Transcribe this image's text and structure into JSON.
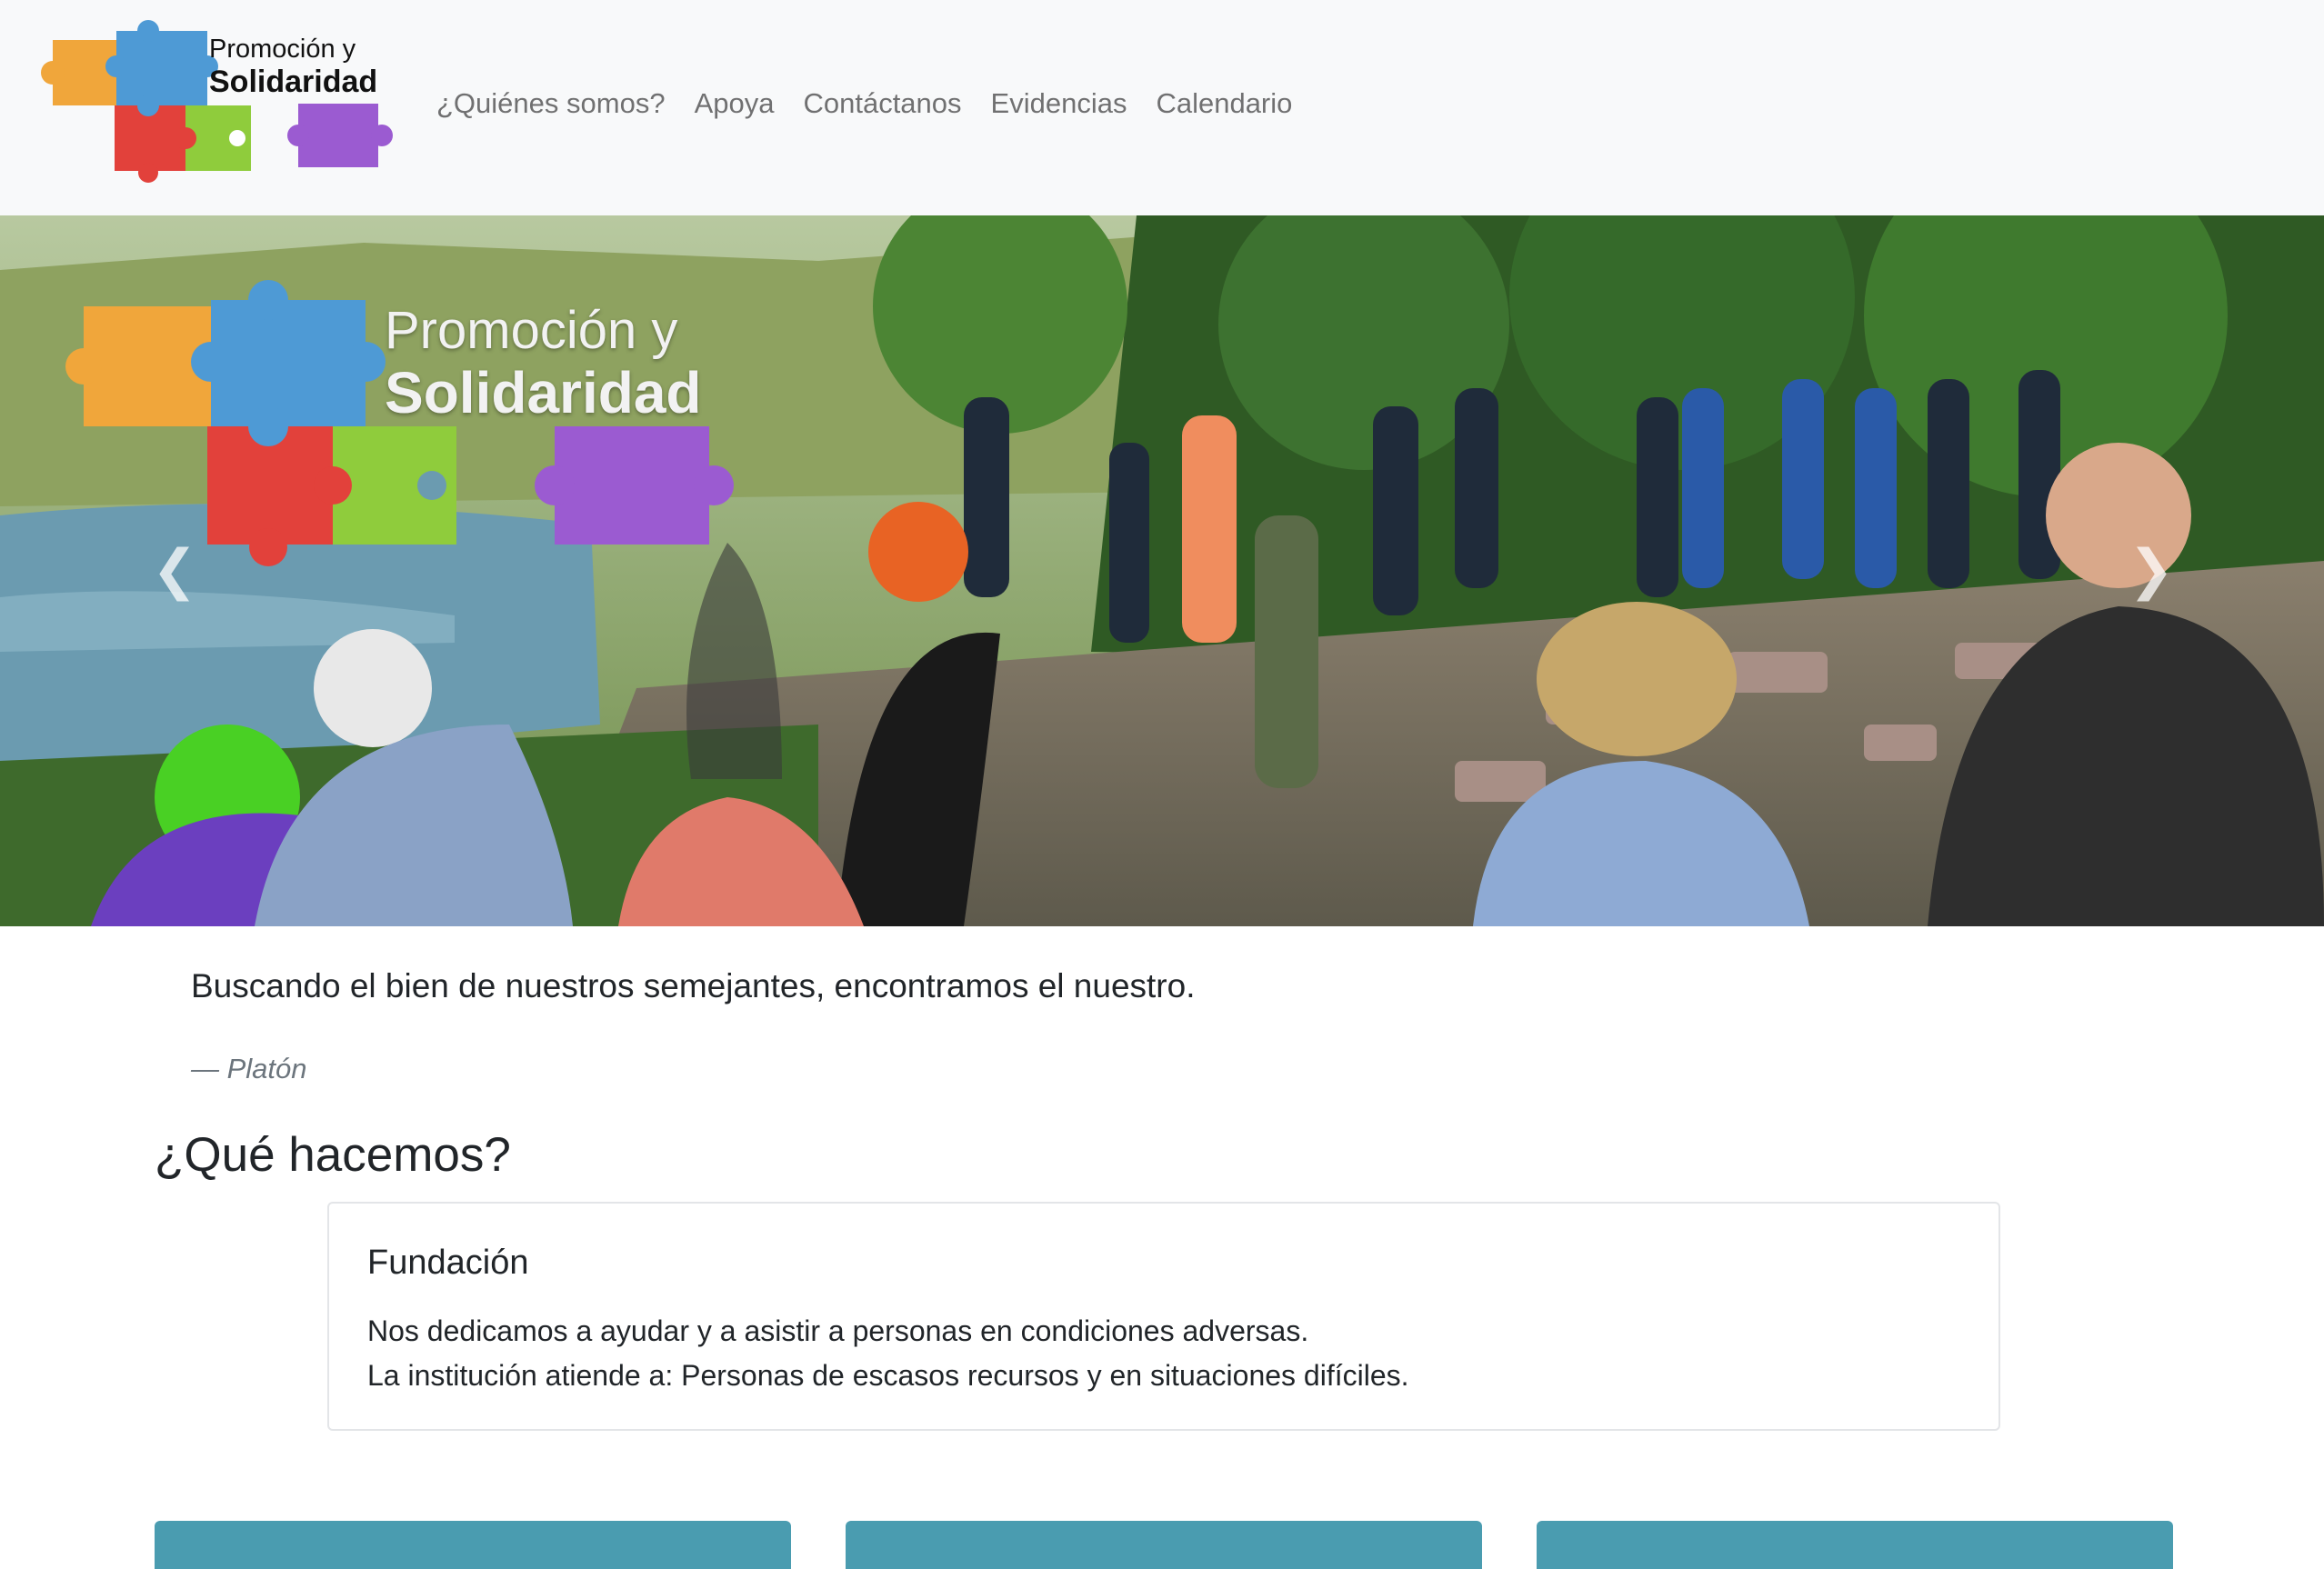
{
  "brand": {
    "line1": "Promoción y",
    "line2": "Solidaridad"
  },
  "nav": {
    "items": [
      {
        "label": "¿Quiénes somos?"
      },
      {
        "label": "Apoya"
      },
      {
        "label": "Contáctanos"
      },
      {
        "label": "Evidencias"
      },
      {
        "label": "Calendario"
      }
    ]
  },
  "carousel": {
    "logo_line1": "Promoción y",
    "logo_line2": "Solidaridad",
    "prev_icon": "chevron-left-icon",
    "next_icon": "chevron-right-icon"
  },
  "quote": {
    "text": "Buscando el bien de nuestros semejantes, encontramos el nuestro.",
    "author": "— Platón"
  },
  "section": {
    "title": "¿Qué hacemos?"
  },
  "card": {
    "title": "Fundación",
    "line1": "Nos dedicamos a ayudar y a asistir a personas en condiciones adversas.",
    "line2": "La institución atiende a: Personas de escasos recursos y en situaciones difíciles."
  },
  "colors": {
    "puzzle_orange": "#f0a63b",
    "puzzle_blue": "#4e9ad5",
    "puzzle_red": "#e2413b",
    "puzzle_green": "#8fcc3c",
    "puzzle_purple": "#9b5bd1",
    "tile_teal": "#4a9cb0",
    "navbar_bg": "#f8f9fa"
  }
}
